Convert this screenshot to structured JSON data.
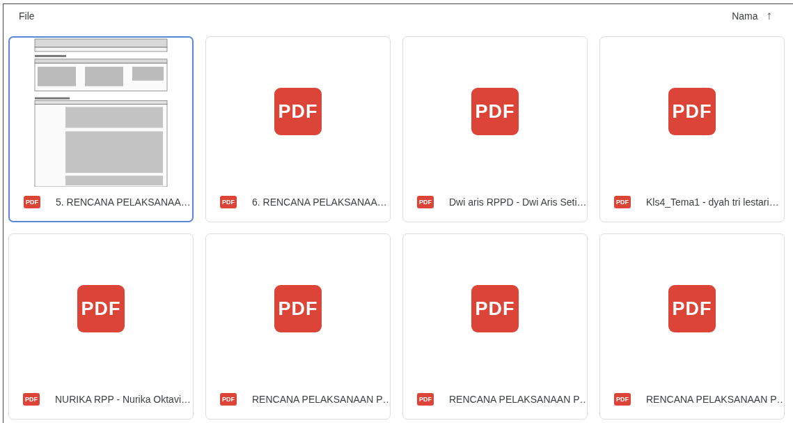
{
  "header": {
    "title": "File",
    "sort_label": "Nama",
    "sort_arrow": "↑"
  },
  "files": [
    {
      "name": "5. RENCANA PELAKSANAA…",
      "kind": "document",
      "badge": "PDF",
      "selected": true
    },
    {
      "name": "6. RENCANA PELAKSANAA…",
      "kind": "pdf",
      "icon_label": "PDF",
      "badge": "PDF",
      "selected": false
    },
    {
      "name": "Dwi aris RPPD - Dwi Aris Seti…",
      "kind": "pdf",
      "icon_label": "PDF",
      "badge": "PDF",
      "selected": false
    },
    {
      "name": "Kls4_Tema1 - dyah tri lestari…",
      "kind": "pdf",
      "icon_label": "PDF",
      "badge": "PDF",
      "selected": false
    },
    {
      "name": "NURIKA RPP - Nurika Oktavi…",
      "kind": "pdf",
      "icon_label": "PDF",
      "badge": "PDF",
      "selected": false
    },
    {
      "name": "RENCANA PELAKSANAAN P…",
      "kind": "pdf",
      "icon_label": "PDF",
      "badge": "PDF",
      "selected": false
    },
    {
      "name": "RENCANA PELAKSANAAN P…",
      "kind": "pdf",
      "icon_label": "PDF",
      "badge": "PDF",
      "selected": false
    },
    {
      "name": "RENCANA PELAKSANAAN P…",
      "kind": "pdf",
      "icon_label": "PDF",
      "badge": "PDF",
      "selected": false
    }
  ]
}
